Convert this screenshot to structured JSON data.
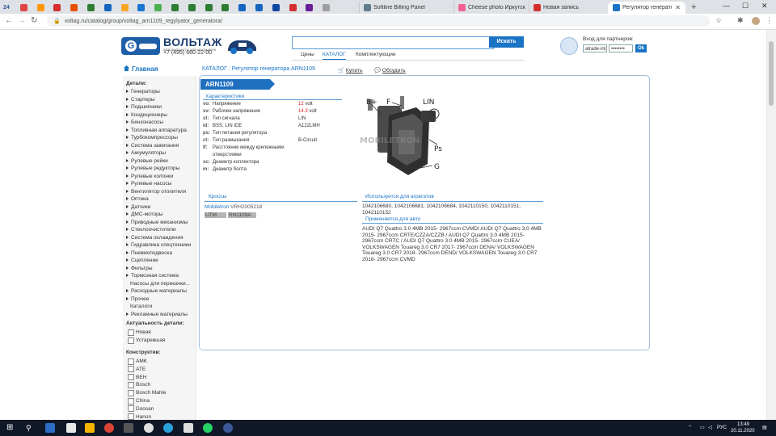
{
  "browser": {
    "small_tabs": [
      {
        "label": "24",
        "color": "#2b579a"
      },
      {
        "label": "",
        "color": "#e04444"
      },
      {
        "label": "",
        "color": "#ff9800"
      },
      {
        "label": "",
        "color": "#d32f2f"
      },
      {
        "label": "",
        "color": "#e65100"
      },
      {
        "label": "",
        "color": "#2e7d32"
      },
      {
        "label": "",
        "color": "#1565c0"
      },
      {
        "label": "",
        "color": "#f9a825"
      },
      {
        "label": "",
        "color": "#1976d2"
      },
      {
        "label": "",
        "color": "#4caf50"
      },
      {
        "label": "",
        "color": "#2e7d32"
      },
      {
        "label": "",
        "color": "#2e7d32"
      },
      {
        "label": "",
        "color": "#2e7d32"
      },
      {
        "label": "",
        "color": "#2e7d32"
      },
      {
        "label": "",
        "color": "#1565c0"
      },
      {
        "label": "",
        "color": "#1565c0"
      },
      {
        "label": "",
        "color": "#0d47a1"
      },
      {
        "label": "",
        "color": "#d32f2f"
      },
      {
        "label": "",
        "color": "#6a1b9a"
      },
      {
        "label": "",
        "color": "#9e9e9e"
      }
    ],
    "titled_tabs": [
      {
        "label": "Softline Billing Panel",
        "color": "#607d8b"
      },
      {
        "label": "Cheese photo Иркутск",
        "color": "#f06292"
      },
      {
        "label": "Новая запись",
        "color": "#d32f2f"
      }
    ],
    "active_tab": {
      "label": "Регулятор генератора",
      "color": "#1a73c4"
    },
    "new_tab_label": "+",
    "close_glyph": "✕",
    "minimize_glyph": "—",
    "maximize_glyph": "☐",
    "url": "voltag.ru/catalog/group/voltag_arn1109_regylyator_generatora/"
  },
  "header": {
    "brand": "ВОЛЬТАЖ",
    "brand_sub": "АВТОЗАПЧАСТИ ДЛЯ ИНОМАРОК",
    "phone": "+7 (495) 660-22-00",
    "search_button": "Искать",
    "nav": [
      "Цены",
      "КАТАЛОГ",
      "Комплектующие"
    ],
    "partners_label": "Вход для партнеров:",
    "login_value": "atrade-irk",
    "password_value": "••••••••",
    "ok_button": "Ok"
  },
  "breadcrumb": {
    "home": "Главная",
    "path": "КАТАЛОГ : Регулятор генератора ARN1109",
    "buy": "Купить",
    "discuss": "Обсудить"
  },
  "sidebar": {
    "details_header": "Детали:",
    "items": [
      "Генераторы",
      "Стартеры",
      "Подшипники",
      "Кондиционеры",
      "Бензонасосы",
      "Топливная аппаратура",
      "Турбокомпрессоры",
      "Система зажигания",
      "Аккумуляторы",
      "Рулевые рейки",
      "Рулевые редукторы",
      "Рулевые колонки",
      "Рулевые насосы",
      "Вентилятор отопителя",
      "Оптика",
      "Датчики",
      "ДМС-моторы",
      "Приводные механизмы",
      "Стеклоочистители",
      "Система охлаждения",
      "Гидравлика спецтехники",
      "Пневмоподвеска",
      "Сцепление",
      "Фильтры",
      "Тормозная система"
    ],
    "sub_item": "Насосы для перекачки...",
    "items2": [
      "Расходные материалы",
      "Прочее"
    ],
    "catalogs": "Каталоги",
    "ads": "Рекламные материалы",
    "actuality_header": "Актуальность детали:",
    "actuality": [
      "Новая",
      "Устаревшая"
    ],
    "constructive_header": "Конструктив:",
    "constructive": [
      "AMK",
      "ATE",
      "BEH",
      "Bosch",
      "Bosch Mahle",
      "China",
      "Doosan",
      "Hanon"
    ]
  },
  "product": {
    "title": "ARN1109",
    "characteristics_header": "Характеристики",
    "characteristics": [
      {
        "code": "vo:",
        "label": "Напряжение",
        "val_red": "12",
        "val": " volt"
      },
      {
        "code": "sv:",
        "label": "Рабочее напряжение",
        "val_red": "14.3",
        "val": " volt"
      },
      {
        "code": "st:",
        "label": "Тип сигнала",
        "val_red": "",
        "val": "LIN"
      },
      {
        "code": "id:",
        "label": "BSS, LIN IDE",
        "val_red": "",
        "val": "A122LMH"
      },
      {
        "code": "ps:",
        "label": "Тип питания регулятора",
        "val_red": "",
        "val": ""
      },
      {
        "code": "ct:",
        "label": "Тип размыкания",
        "val_red": "",
        "val": "B-Circuit"
      },
      {
        "code": "lf:",
        "label": "Расстояние между крепежными",
        "val_red": "",
        "val": ""
      },
      {
        "code": "",
        "label": "отверстиями",
        "val_red": "",
        "val": ""
      },
      {
        "code": "sc:",
        "label": "Диаметр коллектора",
        "val_red": "",
        "val": ""
      },
      {
        "code": "m:",
        "label": "Диаметр болта",
        "val_red": "",
        "val": ""
      }
    ],
    "image_labels": {
      "bplus": "B+",
      "f": "F",
      "lin": "LIN",
      "ps": "Ps",
      "g": "G",
      "watermark": "MOBILETRON"
    },
    "crosses_header": "Кроссы",
    "crosses": [
      {
        "brand": "Mobiletron",
        "code": "VRH2005218"
      },
      {
        "brand": "UTM",
        "code": "RN1109A"
      }
    ],
    "used_header": "Используется для агрегатов",
    "used_in": [
      "1042106680, 1042106681, 1042106684, 1042110150, 1042110151,",
      "1042110152"
    ],
    "applied_header": "Применяется для авто",
    "applied": [
      "AUDI Q7 Quattro 3.0 4MB 2015- 2967ccm CVMD/ AUDI Q7 Quattro 3.0 4MB",
      "2015- 2967ccm CRTE/CZZA/CZZB / AUDI Q7 Quattro 3.0 4MB 2015-",
      "2967ccm CRTC / AUDI Q7 Quattro 3.0 4MB 2015- 2967ccm CUEA/",
      "VOLKSWAGEN Touareg 3.0 CR7 2017- 2967ccm DENA/ VOLKSWAGEN",
      "Touareg 3.0 CR7 2018- 2967ccm DEND/ VOLKSWAGEN Touareg 3.0 CR7",
      "2018- 2967ccm CVMD"
    ]
  },
  "taskbar": {
    "time": "13:49",
    "date": "20.11.2020",
    "lang": "РУС"
  }
}
